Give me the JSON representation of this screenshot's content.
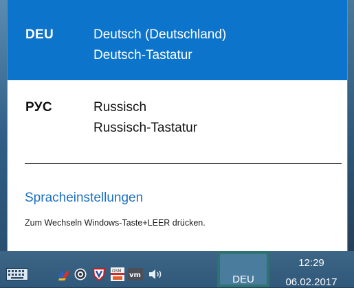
{
  "language_flyout": {
    "languages": [
      {
        "code": "DEU",
        "name": "Deutsch (Deutschland)",
        "keyboard": "Deutsch-Tastatur"
      },
      {
        "code": "РУС",
        "name": "Russisch",
        "keyboard": "Russisch-Tastatur"
      }
    ],
    "settings_link": "Spracheinstellungen",
    "hint": "Zum Wechseln Windows-Taste+LEER drücken."
  },
  "taskbar": {
    "tray_icons": [
      "on-screen-keyboard-icon",
      "security-app-icon",
      "media-app-icon",
      "shield-app-icon",
      "dsm-app-icon",
      "vm-app-icon",
      "volume-icon"
    ],
    "language_indicator": "DEU",
    "clock": {
      "time": "12:29",
      "date": "06.02.2017"
    }
  },
  "colors": {
    "accent": "#0d74cb",
    "link": "#1a6fc4",
    "taskbar": "#30587a",
    "indicator_border": "#2e7370"
  }
}
